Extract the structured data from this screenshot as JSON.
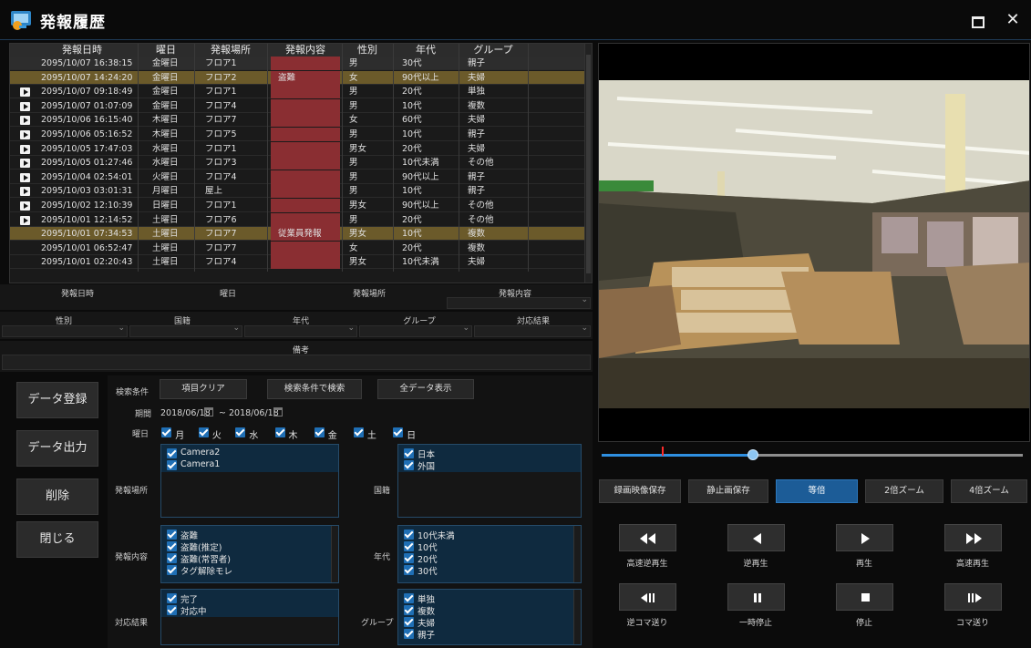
{
  "window": {
    "title": "発報履歴"
  },
  "history": {
    "columns": [
      "発報日時",
      "曜日",
      "発報場所",
      "発報内容",
      "性別",
      "年代",
      "グループ"
    ],
    "rows": [
      {
        "datetime": "2095/10/07 16:38:15",
        "day": "金曜日",
        "place": "フロア1",
        "content": "",
        "gender": "男",
        "age": "30代",
        "group": "親子",
        "style": "sel",
        "video": false
      },
      {
        "datetime": "2095/10/07 14:24:20",
        "day": "金曜日",
        "place": "フロア2",
        "content": "盗難",
        "gender": "女",
        "age": "90代以上",
        "group": "夫婦",
        "style": "hl",
        "video": false
      },
      {
        "datetime": "2095/10/07 09:18:49",
        "day": "金曜日",
        "place": "フロア1",
        "content": "",
        "gender": "男",
        "age": "20代",
        "group": "単独",
        "style": "",
        "video": true
      },
      {
        "datetime": "2095/10/07 01:07:09",
        "day": "金曜日",
        "place": "フロア4",
        "content": "",
        "gender": "男",
        "age": "10代",
        "group": "複数",
        "style": "",
        "video": true
      },
      {
        "datetime": "2095/10/06 16:15:40",
        "day": "木曜日",
        "place": "フロア7",
        "content": "",
        "gender": "女",
        "age": "60代",
        "group": "夫婦",
        "style": "",
        "video": true
      },
      {
        "datetime": "2095/10/06 05:16:52",
        "day": "木曜日",
        "place": "フロア5",
        "content": "",
        "gender": "男",
        "age": "10代",
        "group": "親子",
        "style": "",
        "video": true
      },
      {
        "datetime": "2095/10/05 17:47:03",
        "day": "水曜日",
        "place": "フロア1",
        "content": "",
        "gender": "男女",
        "age": "20代",
        "group": "夫婦",
        "style": "",
        "video": true
      },
      {
        "datetime": "2095/10/05 01:27:46",
        "day": "水曜日",
        "place": "フロア3",
        "content": "",
        "gender": "男",
        "age": "10代未満",
        "group": "その他",
        "style": "",
        "video": true
      },
      {
        "datetime": "2095/10/04 02:54:01",
        "day": "火曜日",
        "place": "フロア4",
        "content": "",
        "gender": "男",
        "age": "90代以上",
        "group": "親子",
        "style": "",
        "video": true
      },
      {
        "datetime": "2095/10/03 03:01:31",
        "day": "月曜日",
        "place": "屋上",
        "content": "",
        "gender": "男",
        "age": "10代",
        "group": "親子",
        "style": "",
        "video": true
      },
      {
        "datetime": "2095/10/02 12:10:39",
        "day": "日曜日",
        "place": "フロア1",
        "content": "",
        "gender": "男女",
        "age": "90代以上",
        "group": "その他",
        "style": "",
        "video": true
      },
      {
        "datetime": "2095/10/01 12:14:52",
        "day": "土曜日",
        "place": "フロア6",
        "content": "",
        "gender": "男",
        "age": "20代",
        "group": "その他",
        "style": "",
        "video": true
      },
      {
        "datetime": "2095/10/01 07:34:53",
        "day": "土曜日",
        "place": "フロア7",
        "content": "従業員発報",
        "gender": "男女",
        "age": "10代",
        "group": "複数",
        "style": "hl",
        "video": false
      },
      {
        "datetime": "2095/10/01 06:52:47",
        "day": "土曜日",
        "place": "フロア7",
        "content": "",
        "gender": "女",
        "age": "20代",
        "group": "複数",
        "style": "",
        "video": false
      },
      {
        "datetime": "2095/10/01 02:20:43",
        "day": "土曜日",
        "place": "フロア4",
        "content": "",
        "gender": "男女",
        "age": "10代未満",
        "group": "夫婦",
        "style": "",
        "video": false
      }
    ]
  },
  "detail": {
    "row1": [
      "発報日時",
      "曜日",
      "発報場所",
      "発報内容"
    ],
    "row2": [
      "性別",
      "国籍",
      "年代",
      "グループ",
      "対応結果"
    ],
    "remarks": "備考"
  },
  "actions": {
    "register": "データ登録",
    "export": "データ出力",
    "delete": "削除",
    "close": "閉じる"
  },
  "search": {
    "criteria_label": "検索条件",
    "clear": "項目クリア",
    "search_by": "検索条件で検索",
    "show_all": "全データ表示",
    "period_label": "期間",
    "date_from": "2018/06/18",
    "tilde": "~",
    "date_to": "2018/06/18",
    "weekday_label": "曜日",
    "weekdays": [
      "月",
      "火",
      "水",
      "木",
      "金",
      "土",
      "日"
    ],
    "place_label": "発報場所",
    "places": [
      "Camera2",
      "Camera1"
    ],
    "nationality_label": "国籍",
    "nationalities": [
      "日本",
      "外国"
    ],
    "content_label": "発報内容",
    "contents": [
      "盗難",
      "盗難(推定)",
      "盗難(常習者)",
      "タグ解除モレ"
    ],
    "age_label": "年代",
    "ages": [
      "10代未満",
      "10代",
      "20代",
      "30代"
    ],
    "result_label": "対応結果",
    "results": [
      "完了",
      "対応中"
    ],
    "group_label": "グループ",
    "groups": [
      "単独",
      "複数",
      "夫婦",
      "親子"
    ]
  },
  "player": {
    "buttons": [
      "録画映像保存",
      "静止画保存",
      "等倍",
      "2倍ズーム",
      "4倍ズーム"
    ],
    "active_button": "等倍",
    "controls": [
      "高速逆再生",
      "逆再生",
      "再生",
      "高速再生",
      "逆コマ送り",
      "一時停止",
      "停止",
      "コマ送り"
    ],
    "position_fraction": 0.36,
    "colors": {
      "accent": "#1c5c97",
      "marker": "#ff2a2a",
      "highlight_row": "#6b5a2a",
      "alert_cell": "#8a2e32"
    }
  }
}
